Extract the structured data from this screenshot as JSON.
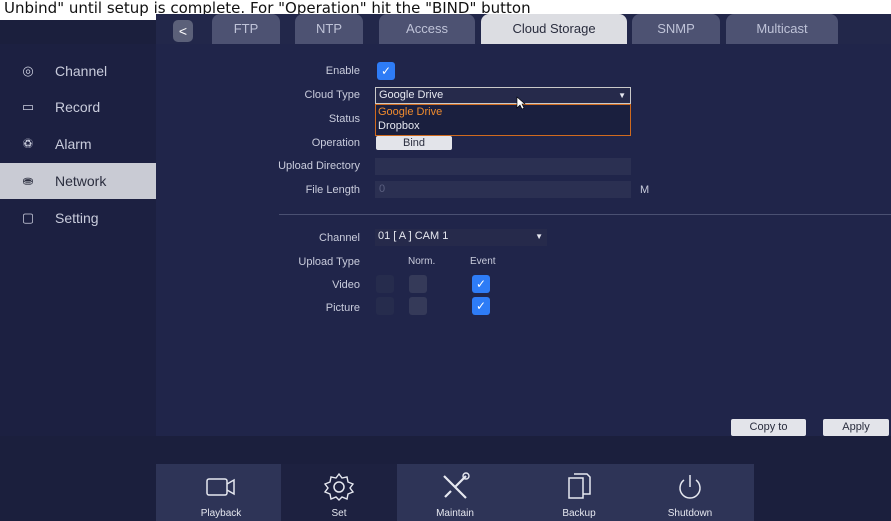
{
  "caption": "Unbind\" until setup is complete. For \"Operation\" hit the \"BIND\" button",
  "tabs": {
    "back": "<",
    "items": [
      "FTP",
      "NTP",
      "Access",
      "Cloud Storage",
      "SNMP",
      "Multicast"
    ],
    "active": "Cloud Storage"
  },
  "sidebar": {
    "items": [
      {
        "label": "Channel",
        "icon": "camera-icon"
      },
      {
        "label": "Record",
        "icon": "record-icon"
      },
      {
        "label": "Alarm",
        "icon": "bell-icon"
      },
      {
        "label": "Network",
        "icon": "network-icon",
        "active": true
      },
      {
        "label": "Setting",
        "icon": "monitor-icon"
      }
    ]
  },
  "form": {
    "enable_label": "Enable",
    "enable_checked": true,
    "cloud_type_label": "Cloud Type",
    "cloud_type_value": "Google Drive",
    "cloud_type_options": [
      "Google Drive",
      "Dropbox"
    ],
    "status_label": "Status",
    "operation_label": "Operation",
    "bind_label": "Bind",
    "upload_dir_label": "Upload Directory",
    "upload_dir_value": "",
    "file_length_label": "File Length",
    "file_length_value": "0",
    "file_length_unit": "M"
  },
  "upload": {
    "channel_label": "Channel",
    "channel_value": "01 [ A ] CAM 1",
    "upload_type_label": "Upload Type",
    "col_norm": "Norm.",
    "col_event": "Event",
    "video_label": "Video",
    "picture_label": "Picture",
    "video_event_checked": true,
    "picture_event_checked": true
  },
  "actions": {
    "copy_to": "Copy to",
    "apply": "Apply"
  },
  "dock": {
    "items": [
      {
        "label": "Playback",
        "icon": "playback-icon"
      },
      {
        "label": "Set",
        "icon": "gear-icon",
        "active": true
      },
      {
        "label": "Maintain",
        "icon": "tools-icon"
      },
      {
        "label": "Backup",
        "icon": "backup-icon"
      },
      {
        "label": "Shutdown",
        "icon": "power-icon"
      }
    ]
  },
  "colors": {
    "accent": "#2e7cf6",
    "dropdown_highlight": "#f08b2e",
    "background": "#20254a"
  }
}
